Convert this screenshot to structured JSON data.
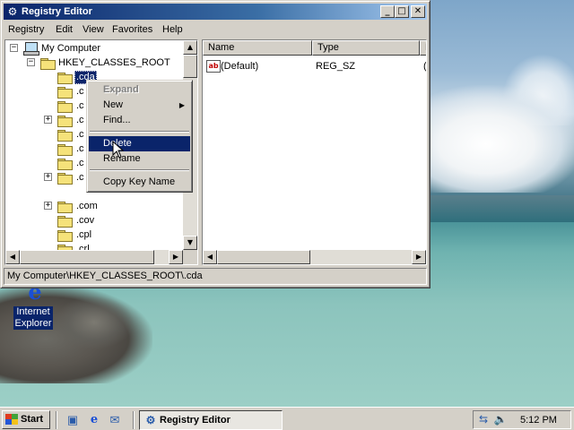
{
  "window": {
    "title": "Registry Editor",
    "buttons": {
      "minimize": "_",
      "maximize": "□",
      "close": "✕"
    }
  },
  "menubar": {
    "items": [
      "Registry",
      "Edit",
      "View",
      "Favorites",
      "Help"
    ]
  },
  "tree": {
    "root": "My Computer",
    "hive": "HKEY_CLASSES_ROOT",
    "nodes": [
      ".cda",
      ".c",
      ".c",
      ".c",
      ".c",
      ".c",
      ".c",
      ".c",
      ".com",
      ".cov",
      ".cpl",
      ".crl"
    ],
    "selected": ".cda"
  },
  "list": {
    "columns": [
      "Name",
      "Type",
      "D"
    ],
    "rows": [
      {
        "name": "(Default)",
        "type": "REG_SZ",
        "data": "("
      }
    ],
    "row_icon": "ab"
  },
  "context_menu": {
    "items": [
      "Expand",
      "New",
      "Find...",
      "Delete",
      "Rename",
      "Copy Key Name"
    ],
    "highlighted": "Delete",
    "disabled": "Expand"
  },
  "statusbar": {
    "path": "My Computer\\HKEY_CLASSES_ROOT\\.cda"
  },
  "desktop": {
    "icons": [
      {
        "label_line1": "Internet",
        "label_line2": "Explorer"
      }
    ]
  },
  "taskbar": {
    "start_label": "Start",
    "task_label": "Registry Editor",
    "clock": "5:12 PM"
  },
  "colors": {
    "selection": "#0a246a",
    "face": "#d4d0c8"
  }
}
